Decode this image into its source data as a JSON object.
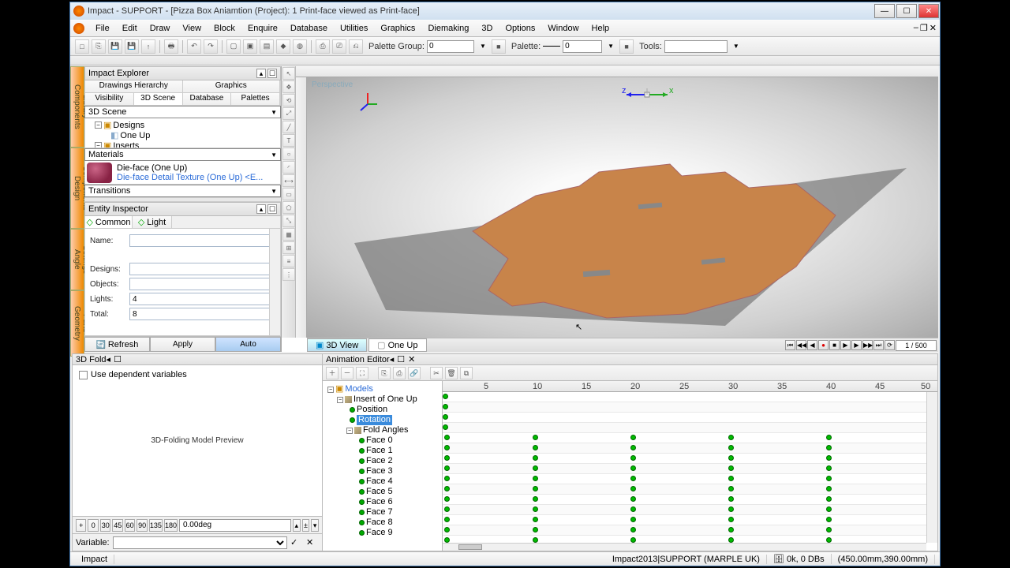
{
  "title": "Impact - SUPPORT - [Pizza Box Aniamtion (Project): 1 Print-face viewed as  Print-face]",
  "menu": [
    "File",
    "Edit",
    "Draw",
    "View",
    "Block",
    "Enquire",
    "Database",
    "Utilities",
    "Graphics",
    "Diemaking",
    "3D",
    "Options",
    "Window",
    "Help"
  ],
  "toolbar": {
    "palette_group_label": "Palette Group:",
    "palette_group_value": "0",
    "palette_label": "Palette:",
    "palette_value": "0",
    "tools_label": "Tools:"
  },
  "sidetabs": [
    "Components Library",
    "Design Components",
    "Angle Settings",
    "Geometry Parts"
  ],
  "explorer": {
    "header": "Impact Explorer",
    "tabs1": [
      "Drawings Hierarchy",
      "Graphics"
    ],
    "tabs2": [
      "Visibility",
      "3D Scene",
      "Database",
      "Palettes"
    ],
    "scene_label": "3D Scene",
    "tree": {
      "designs": "Designs",
      "oneup": "One Up",
      "inserts": "Inserts"
    },
    "materials_label": "Materials",
    "material_name": "Die-face (One Up)",
    "material_detail": "Die-face Detail Texture (One Up) <E...",
    "transitions_label": "Transitions"
  },
  "inspector": {
    "header": "Entity Inspector",
    "tabs": [
      "Common",
      "Light"
    ],
    "labels": {
      "name": "Name:",
      "designs": "Designs:",
      "objects": "Objects:",
      "lights": "Lights:",
      "total": "Total:"
    },
    "values": {
      "name": "",
      "designs": "",
      "objects": "",
      "lights": "4",
      "total": "8"
    },
    "buttons": {
      "refresh": "Refresh",
      "apply": "Apply",
      "auto": "Auto"
    }
  },
  "viewport": {
    "label": "Perspective",
    "tabs": [
      "3D View",
      "One Up"
    ],
    "frame": "1 / 500"
  },
  "fold": {
    "header": "3D Fold",
    "checkbox": "Use dependent variables",
    "preview": "3D-Folding Model Preview",
    "angles": [
      "+",
      "0",
      "30",
      "45",
      "60",
      "90",
      "135",
      "180"
    ],
    "degvalue": "0.00deg",
    "variable_label": "Variable:"
  },
  "anim": {
    "header": "Animation Editor",
    "tree": {
      "models": "Models",
      "insert": "Insert of One Up",
      "position": "Position",
      "rotation": "Rotation",
      "foldangles": "Fold Angles",
      "faces": [
        "Face 0",
        "Face 1",
        "Face 2",
        "Face 3",
        "Face 4",
        "Face 5",
        "Face 6",
        "Face 7",
        "Face 8",
        "Face 9"
      ]
    },
    "ticks": [
      "5",
      "10",
      "15",
      "20",
      "25",
      "30",
      "35",
      "40",
      "45",
      "50"
    ]
  },
  "status": {
    "left": "Impact",
    "right1": "Impact2013|SUPPORT (MARPLE UK)",
    "right2": "0k, 0 DBs",
    "right3": "(450.00mm,390.00mm)"
  }
}
